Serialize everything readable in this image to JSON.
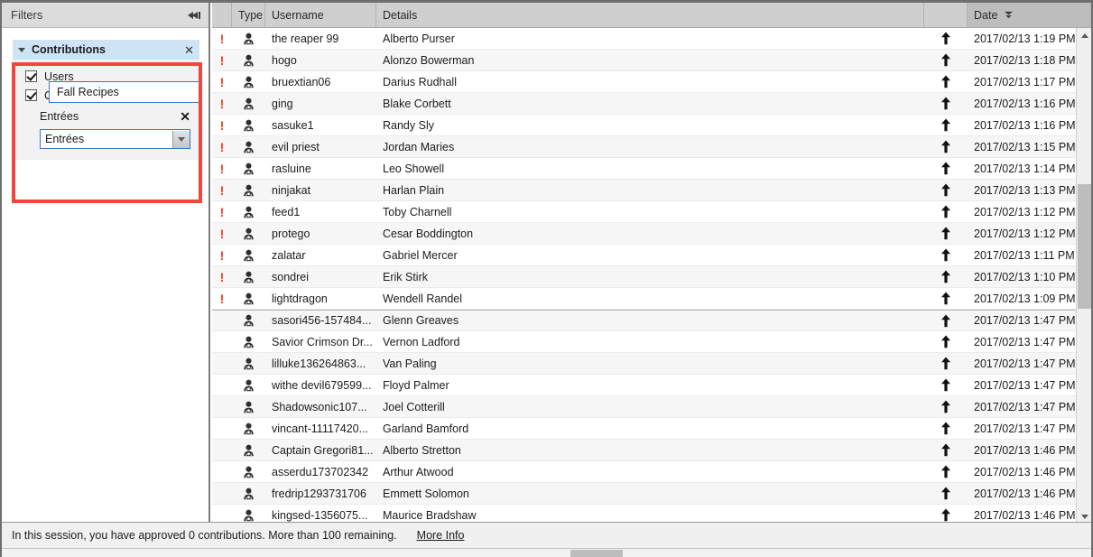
{
  "filters": {
    "title": "Filters",
    "collapse_icon": "collapse-left-icon",
    "section": {
      "label": "Contributions",
      "caret_icon": "caret-down-icon",
      "close_icon": "close-icon",
      "checkboxes": [
        {
          "label": "Users",
          "checked": true
        },
        {
          "label": "Comments & Reviews",
          "checked": true
        }
      ],
      "subfilter": {
        "label": "Entrées",
        "close_icon": "close-icon",
        "combo_value": "Entrées",
        "combo_arrow_icon": "chevron-down-icon",
        "dropdown_open": true,
        "dropdown_options": [
          "Fall Recipes"
        ]
      }
    },
    "highlight_color": "#f0473c"
  },
  "table": {
    "columns": [
      "",
      "Type",
      "Username",
      "Details",
      "",
      "Date"
    ],
    "sort_column": "Date",
    "sort_icon": "sort-descending-icon",
    "rows": [
      {
        "flag": "!",
        "type_icon": "person-icon",
        "username": "the reaper 99",
        "details": "Alberto Purser",
        "arrow_icon": "arrow-up-icon",
        "date": "2017/02/13 1:19 PM"
      },
      {
        "flag": "!",
        "type_icon": "person-icon",
        "username": "hogo",
        "details": "Alonzo Bowerman",
        "arrow_icon": "arrow-up-icon",
        "date": "2017/02/13 1:18 PM"
      },
      {
        "flag": "!",
        "type_icon": "person-icon",
        "username": "bruextian06",
        "details": "Darius Rudhall",
        "arrow_icon": "arrow-up-icon",
        "date": "2017/02/13 1:17 PM"
      },
      {
        "flag": "!",
        "type_icon": "person-icon",
        "username": "ging",
        "details": "Blake Corbett",
        "arrow_icon": "arrow-up-icon",
        "date": "2017/02/13 1:16 PM"
      },
      {
        "flag": "!",
        "type_icon": "person-icon",
        "username": "sasuke1",
        "details": "Randy Sly",
        "arrow_icon": "arrow-up-icon",
        "date": "2017/02/13 1:16 PM"
      },
      {
        "flag": "!",
        "type_icon": "person-icon",
        "username": "evil priest",
        "details": "Jordan Maries",
        "arrow_icon": "arrow-up-icon",
        "date": "2017/02/13 1:15 PM"
      },
      {
        "flag": "!",
        "type_icon": "person-icon",
        "username": "rasluine",
        "details": "Leo Showell",
        "arrow_icon": "arrow-up-icon",
        "date": "2017/02/13 1:14 PM"
      },
      {
        "flag": "!",
        "type_icon": "person-icon",
        "username": "ninjakat",
        "details": "Harlan Plain",
        "arrow_icon": "arrow-up-icon",
        "date": "2017/02/13 1:13 PM"
      },
      {
        "flag": "!",
        "type_icon": "person-icon",
        "username": "feed1",
        "details": "Toby Charnell",
        "arrow_icon": "arrow-up-icon",
        "date": "2017/02/13 1:12 PM"
      },
      {
        "flag": "!",
        "type_icon": "person-icon",
        "username": "protego",
        "details": "Cesar Boddington",
        "arrow_icon": "arrow-up-icon",
        "date": "2017/02/13 1:12 PM"
      },
      {
        "flag": "!",
        "type_icon": "person-icon",
        "username": "zalatar",
        "details": "Gabriel Mercer",
        "arrow_icon": "arrow-up-icon",
        "date": "2017/02/13 1:11 PM"
      },
      {
        "flag": "!",
        "type_icon": "person-icon",
        "username": "sondrei",
        "details": "Erik Stirk",
        "arrow_icon": "arrow-up-icon",
        "date": "2017/02/13 1:10 PM"
      },
      {
        "flag": "!",
        "type_icon": "person-icon",
        "username": "lightdragon",
        "details": "Wendell Randel",
        "arrow_icon": "arrow-up-icon",
        "date": "2017/02/13 1:09 PM"
      },
      {
        "flag": "",
        "type_icon": "person-icon",
        "username": "sasori456-157484...",
        "details": "Glenn Greaves",
        "arrow_icon": "arrow-up-icon",
        "date": "2017/02/13 1:47 PM",
        "group_start": true
      },
      {
        "flag": "",
        "type_icon": "person-icon",
        "username": "Savior Crimson Dr...",
        "details": "Vernon Ladford",
        "arrow_icon": "arrow-up-icon",
        "date": "2017/02/13 1:47 PM"
      },
      {
        "flag": "",
        "type_icon": "person-icon",
        "username": "lilluke136264863...",
        "details": "Van Paling",
        "arrow_icon": "arrow-up-icon",
        "date": "2017/02/13 1:47 PM"
      },
      {
        "flag": "",
        "type_icon": "person-icon",
        "username": "withe devil679599...",
        "details": "Floyd Palmer",
        "arrow_icon": "arrow-up-icon",
        "date": "2017/02/13 1:47 PM"
      },
      {
        "flag": "",
        "type_icon": "person-icon",
        "username": "Shadowsonic107...",
        "details": "Joel Cotterill",
        "arrow_icon": "arrow-up-icon",
        "date": "2017/02/13 1:47 PM"
      },
      {
        "flag": "",
        "type_icon": "person-icon",
        "username": "vincant-11117420...",
        "details": "Garland Bamford",
        "arrow_icon": "arrow-up-icon",
        "date": "2017/02/13 1:47 PM"
      },
      {
        "flag": "",
        "type_icon": "person-icon",
        "username": "Captain Gregori81...",
        "details": "Alberto Stretton",
        "arrow_icon": "arrow-up-icon",
        "date": "2017/02/13 1:46 PM"
      },
      {
        "flag": "",
        "type_icon": "person-icon",
        "username": "asserdu173702342",
        "details": "Arthur Atwood",
        "arrow_icon": "arrow-up-icon",
        "date": "2017/02/13 1:46 PM"
      },
      {
        "flag": "",
        "type_icon": "person-icon",
        "username": "fredrip1293731706",
        "details": "Emmett Solomon",
        "arrow_icon": "arrow-up-icon",
        "date": "2017/02/13 1:46 PM"
      },
      {
        "flag": "",
        "type_icon": "person-icon",
        "username": "kingsed-1356075...",
        "details": "Maurice Bradshaw",
        "arrow_icon": "arrow-up-icon",
        "date": "2017/02/13 1:46 PM"
      }
    ]
  },
  "statusbar": {
    "text": "In this session, you have approved 0 contributions. More than 100 remaining.",
    "more_info": "More Info"
  }
}
